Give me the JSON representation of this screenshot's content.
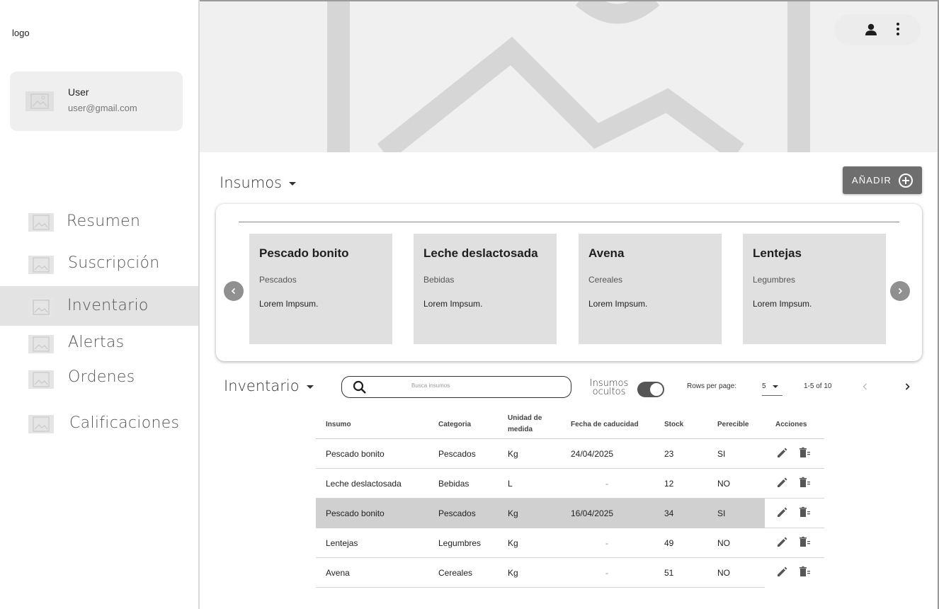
{
  "sidebar": {
    "logo": "logo",
    "user": {
      "name": "User",
      "email": "user@gmail.com"
    },
    "items": [
      {
        "label": "Resumen"
      },
      {
        "label": "Suscripción"
      },
      {
        "label": "Inventario"
      },
      {
        "label": "Alertas"
      },
      {
        "label": "Ordenes"
      },
      {
        "label": "Calificaciones"
      }
    ],
    "active_item": "Inventario"
  },
  "header": {
    "actions": [
      "user-icon",
      "more-vert-icon"
    ]
  },
  "insumos": {
    "title": "Insumos",
    "add_label": "AÑADIR",
    "cards": [
      {
        "title": "Pescado bonito",
        "category": "Pescados",
        "desc": "Lorem Impsum."
      },
      {
        "title": "Leche deslactosada",
        "category": "Bebidas",
        "desc": "Lorem Impsum."
      },
      {
        "title": "Avena",
        "category": "Cereales",
        "desc": "Lorem Impsum."
      },
      {
        "title": "Lentejas",
        "category": "Legumbres",
        "desc": "Lorem Impsum."
      }
    ]
  },
  "inventario": {
    "title": "Inventario",
    "search_placeholder": "Busca insumos",
    "toggle_label_1": "Insumos",
    "toggle_label_2": "ocultos",
    "toggle_on": true,
    "rows_per_page_label": "Rows per page:",
    "rows_per_page": "5",
    "range": "1-5 of 10",
    "columns": [
      "Insumo",
      "Categoria",
      "Unidad de medida",
      "Fecha de caducidad",
      "Stock",
      "Perecible",
      "Acciones"
    ],
    "rows": [
      {
        "insumo": "Pescado bonito",
        "categoria": "Pescados",
        "unidad": "Kg",
        "fecha": "24/04/2025",
        "stock": "23",
        "perecible": "SI"
      },
      {
        "insumo": "Leche deslactosada",
        "categoria": "Bebidas",
        "unidad": "L",
        "fecha": "-",
        "stock": "12",
        "perecible": "NO"
      },
      {
        "insumo": "Pescado bonito",
        "categoria": "Pescados",
        "unidad": "Kg",
        "fecha": "16/04/2025",
        "stock": "34",
        "perecible": "SI"
      },
      {
        "insumo": "Lentejas",
        "categoria": "Legumbres",
        "unidad": "Kg",
        "fecha": "-",
        "stock": "49",
        "perecible": "NO"
      },
      {
        "insumo": "Avena",
        "categoria": "Cereales",
        "unidad": "Kg",
        "fecha": "-",
        "stock": "51",
        "perecible": "NO"
      }
    ],
    "highlighted_row": 2
  },
  "colors": {
    "accent_button": "#6e6e6e",
    "card_bg": "#e0e0e0",
    "highlight_row": "#d0d0d0"
  }
}
